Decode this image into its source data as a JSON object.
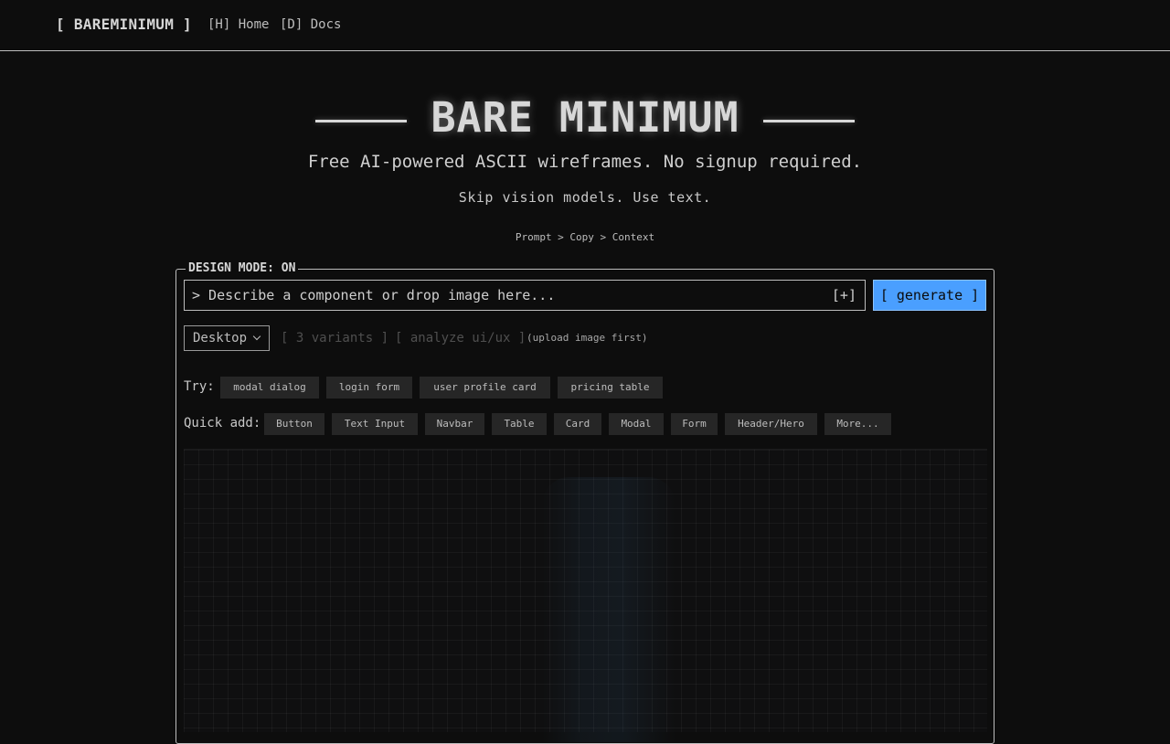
{
  "nav": {
    "brand": "[ BAREMINIMUM ]",
    "links": [
      "[H] Home",
      "[D] Docs"
    ]
  },
  "hero": {
    "title": "BARE MINIMUM",
    "tagline": "Free AI-powered ASCII wireframes. No signup required.",
    "subtag": "Skip vision models. Use text.",
    "flow": "Prompt > Copy > Context"
  },
  "panel": {
    "legend": "DESIGN MODE: ON",
    "prompt_placeholder": "> Describe a component or drop image here...",
    "attach_label": "[+]",
    "generate_label": "[ generate ]",
    "device_selected": "Desktop",
    "variants_label": "[ 3 variants ]",
    "analyze_label": "[ analyze ui/ux ]",
    "analyze_hint": "(upload image first)",
    "try_label": "Try:",
    "try_chips": [
      "modal dialog",
      "login form",
      "user profile card",
      "pricing table"
    ],
    "quick_label": "Quick add:",
    "quick_chips": [
      "Button",
      "Text Input",
      "Navbar",
      "Table",
      "Card",
      "Modal",
      "Form",
      "Header/Hero",
      "More..."
    ]
  },
  "colors": {
    "background": "#0d0d0d",
    "accent": "#4a9fff",
    "chip_bg": "#262626"
  }
}
